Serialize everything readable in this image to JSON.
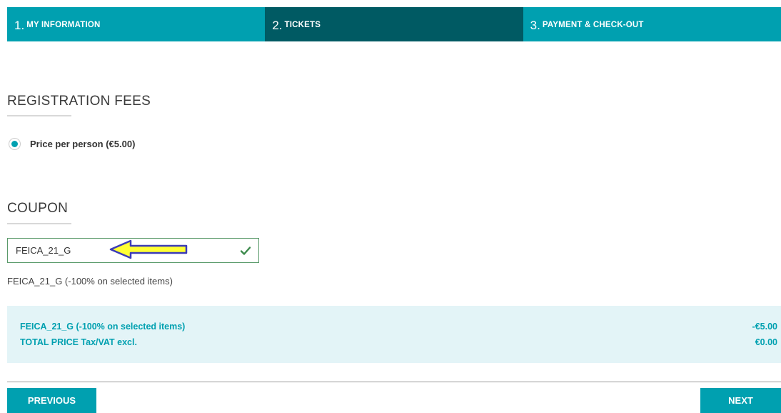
{
  "steps": [
    {
      "num": "1.",
      "label": "MY INFORMATION",
      "active": false
    },
    {
      "num": "2.",
      "label": "TICKETS",
      "active": true
    },
    {
      "num": "3.",
      "label": "PAYMENT & CHECK-OUT",
      "active": false
    }
  ],
  "registration": {
    "title": "REGISTRATION FEES",
    "option_label": "Price per person (€5.00)",
    "selected": true
  },
  "coupon": {
    "title": "COUPON",
    "value": "FEICA_21_G",
    "status_icon": "check-icon",
    "description": "FEICA_21_G (-100% on selected items)"
  },
  "summary": {
    "rows": [
      {
        "label": "FEICA_21_G (-100% on selected items)",
        "amount": "-€5.00"
      },
      {
        "label": "TOTAL PRICE Tax/VAT excl.",
        "amount": "€0.00"
      }
    ]
  },
  "nav": {
    "previous_label": "PREVIOUS",
    "next_label": "NEXT"
  },
  "colors": {
    "accent": "#00a0b0",
    "accent_dark": "#005a63",
    "summary_bg": "#e3f4f7",
    "valid_green": "#5a9a6a",
    "annotation_arrow": "#ffff33"
  }
}
